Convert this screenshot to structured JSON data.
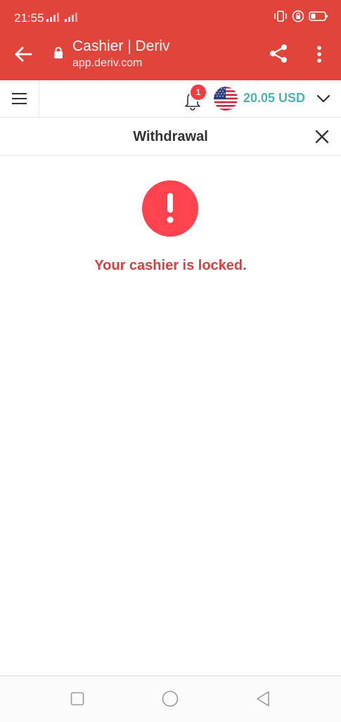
{
  "status_bar": {
    "time": "21:55"
  },
  "browser": {
    "page_title": "Cashier | Deriv",
    "url": "app.deriv.com"
  },
  "header": {
    "notification_count": "1",
    "balance": "20.05 USD"
  },
  "modal": {
    "title": "Withdrawal",
    "message": "Your cashier is locked."
  },
  "colors": {
    "chrome_red": "#e0443a",
    "alert_red": "#ff444f",
    "message_red": "#d74040",
    "balance_teal": "#4bb4b3"
  }
}
